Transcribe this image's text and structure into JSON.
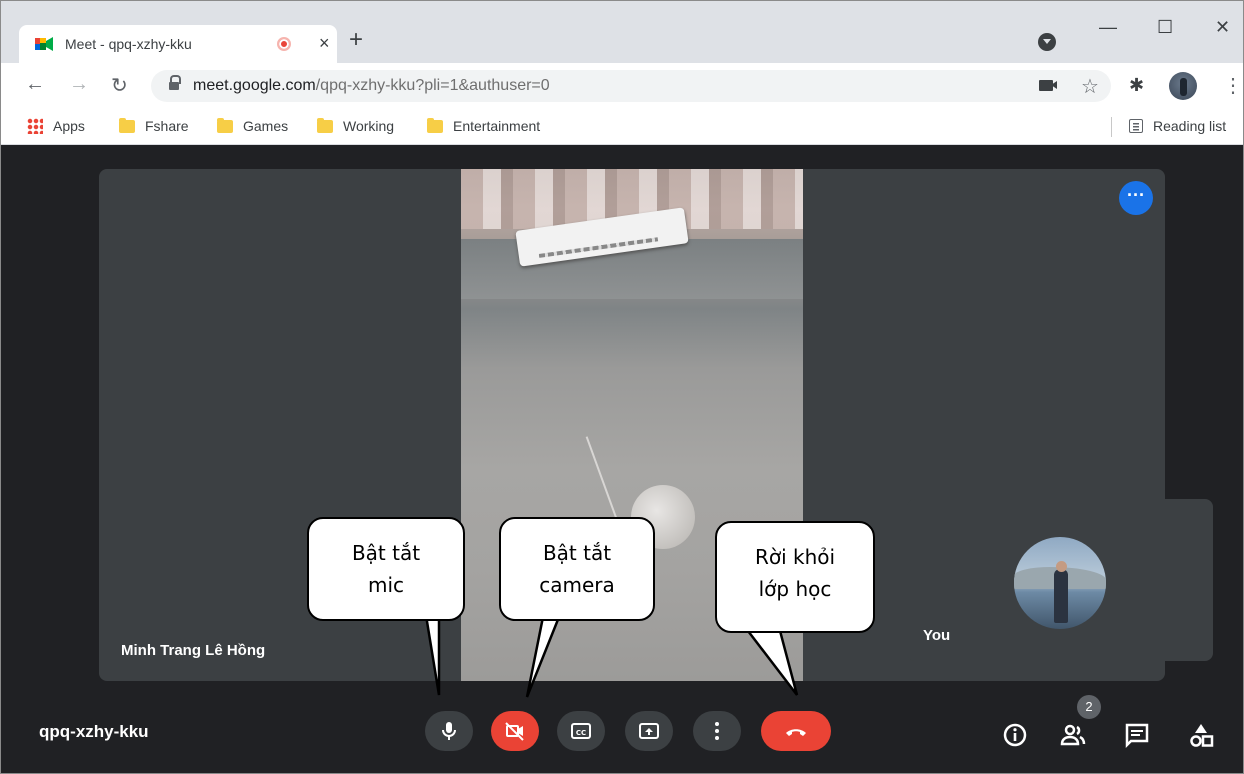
{
  "browser": {
    "tab_title": "Meet - qpq-xzhy-kku",
    "new_tab": "+",
    "close_tab": "×",
    "url_host": "meet.google.com",
    "url_path": "/qpq-xzhy-kku?pli=1&authuser=0",
    "window_controls": {
      "minimize": "—",
      "maximize": "☐",
      "close": "✕"
    },
    "bookmarks": [
      {
        "label": "Apps",
        "icon": "apps-grid-icon"
      },
      {
        "label": "Fshare",
        "icon": "folder-icon"
      },
      {
        "label": "Games",
        "icon": "folder-icon"
      },
      {
        "label": "Working",
        "icon": "folder-icon"
      },
      {
        "label": "Entertainment",
        "icon": "folder-icon"
      }
    ],
    "reading_list": "Reading list"
  },
  "meet": {
    "main_participant_name": "Minh Trang Lê Hồng",
    "self_label": "You",
    "meeting_code": "qpq-xzhy-kku",
    "people_count": "2",
    "controls": [
      "microphone-icon",
      "camera-off-icon",
      "captions-icon",
      "present-screen-icon",
      "more-options-icon",
      "end-call-icon"
    ],
    "side_controls": [
      "info-icon",
      "people-icon",
      "chat-icon",
      "activities-icon"
    ],
    "colors": {
      "end_call": "#ea4335",
      "camera_off": "#ea4335",
      "more_button": "#1a73e8",
      "background": "#202124",
      "tile": "#3c4043"
    }
  },
  "callouts": {
    "mic": [
      "Bật tắt",
      "mic"
    ],
    "camera": [
      "Bật tắt",
      "camera"
    ],
    "leave": [
      "Rời khỏi",
      "lớp học"
    ]
  }
}
